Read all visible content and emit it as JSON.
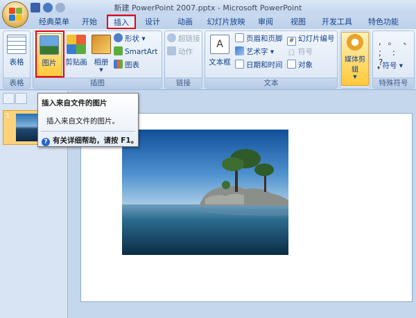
{
  "window": {
    "title": "新建 PowerPoint 2007.pptx - Microsoft PowerPoint"
  },
  "tabs": [
    "经典菜单",
    "开始",
    "插入",
    "设计",
    "动画",
    "幻灯片放映",
    "审阅",
    "视图",
    "开发工具",
    "特色功能"
  ],
  "active_tab": "插入",
  "ribbon": {
    "groups": {
      "tables": {
        "label": "表格",
        "button": "表格"
      },
      "illustrations": {
        "label": "插图",
        "picture": "图片",
        "clipart": "剪贴画",
        "album": "相册",
        "shapes": "形状",
        "smartart": "SmartArt",
        "chart": "图表"
      },
      "links": {
        "label": "链接",
        "hyperlink": "超链接",
        "action": "动作"
      },
      "text": {
        "label": "文本",
        "textbox": "文本框",
        "header_footer": "页眉和页脚",
        "wordart": "艺术字",
        "datetime": "日期和时间",
        "slide_number": "幻灯片编号",
        "symbol": "符号",
        "object": "对象"
      },
      "media": {
        "label": "媒体剪辑",
        "button": "媒体剪辑"
      },
      "special": {
        "label": "特殊符号",
        "symbol": "符号",
        "row1": ", 。 、",
        "row2": "; : ?"
      }
    }
  },
  "tooltip": {
    "title": "插入来自文件的图片",
    "description": "插入来自文件的图片。",
    "help": "有关详细帮助，请按 F1。"
  },
  "slides_pane": {
    "slide_number": "1"
  },
  "colors": {
    "highlight": "#e60012",
    "ribbon_bg": "#dde8f5",
    "tab_active": "#e4ecf7"
  }
}
